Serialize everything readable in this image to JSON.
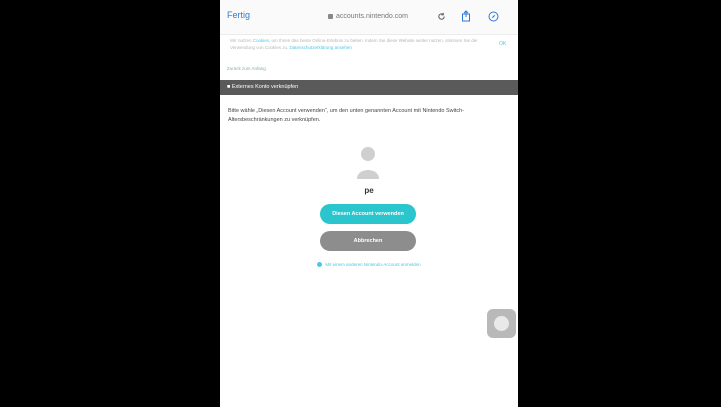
{
  "browser": {
    "done_label": "Fertig",
    "url": "accounts.nintendo.com"
  },
  "cookie_banner": {
    "text_before": "Wir nutzen ",
    "link1": "Cookies",
    "text_middle": ", um Ihnen das beste Online-Erlebnis zu bieten. Indem Sie diese Website weiter nutzen, stimmen Sie der Verwendung von Cookies zu. ",
    "link2": "Datenschutzerklärung ansehen",
    "ok_label": "OK"
  },
  "back_link": "Zurück zum Anfang",
  "section_title": "Externes Konto verknüpfen",
  "description": "Bitte wähle „Diesen Account verwenden“, um den unten genannten Account mit Nintendo Switch-Altersbeschränkungen zu verknüpfen.",
  "account": {
    "username": "pe"
  },
  "buttons": {
    "use_account": "Diesen Account verwenden",
    "cancel": "Abbrechen"
  },
  "other_account_link": "Mit einem anderen Nintendo-Account anmelden",
  "colors": {
    "accent": "#2bc5cd",
    "cancel": "#8d8d8d",
    "section_bar": "#5a5a5a"
  }
}
